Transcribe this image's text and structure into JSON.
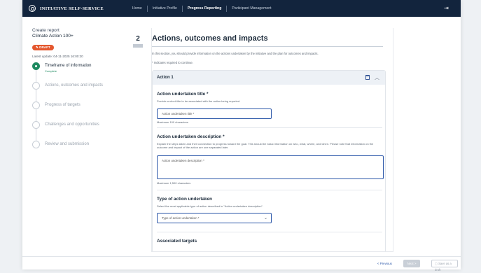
{
  "header": {
    "brand": "INITIATIVE SELF-SERVICE",
    "nav": [
      "Home",
      "Initiative Profile",
      "Progress Reporting",
      "Participant Management"
    ],
    "active_index": 2
  },
  "sidebar": {
    "create_label": "Create report",
    "initiative": "Climate Action 100+",
    "badge": "DRAFT",
    "updated": "Latest update: 04-11-2025 16:00:20",
    "steps": [
      {
        "label": "Timeframe of information",
        "sub": "Complete",
        "state": "done"
      },
      {
        "label": "Actions, outcomes and impacts",
        "sub": "",
        "state": "current"
      },
      {
        "label": "Progress of targets",
        "sub": "",
        "state": "todo"
      },
      {
        "label": "Challenges and opportunities",
        "sub": "",
        "state": "todo"
      },
      {
        "label": "Review and submission",
        "sub": "",
        "state": "todo"
      }
    ]
  },
  "main": {
    "step_number": "2",
    "title": "Actions, outcomes and impacts",
    "intro": "In this section, you should provide information on the actions undertaken by the initiative and the plan for outcomes and impacts.",
    "required_note": "* Indicates required to continue.",
    "action": {
      "title": "Action 1",
      "title_label": "Action undertaken title *",
      "title_hint": "Provide a short title to be associated with the action being reported.",
      "title_placeholder": "Action undertaken title *",
      "title_max": "Maximum 100 characters",
      "desc_label": "Action undertaken description *",
      "desc_hint": "Explain the steps taken and their connection to progress toward the goal. This should be basic information on who, what, where, and when. Please note that information on the outcome and impact of the action are one separated later.",
      "desc_placeholder": "Action undertaken description *",
      "desc_max": "Maximum 1,500 characters",
      "type_label": "Type of action undertaken",
      "type_hint": "Select the most applicable type of action described in \"Action undertaken description\".",
      "type_placeholder": "Type of action undertaken *",
      "targets_label": "Associated targets"
    }
  },
  "footer": {
    "previous": "< Previous",
    "next": "Next >",
    "save_draft": "Save as a draft"
  },
  "colors": {
    "topbar": "#12243d",
    "badge": "#e4572e",
    "complete": "#1e8a60",
    "link": "#2a56a8"
  }
}
